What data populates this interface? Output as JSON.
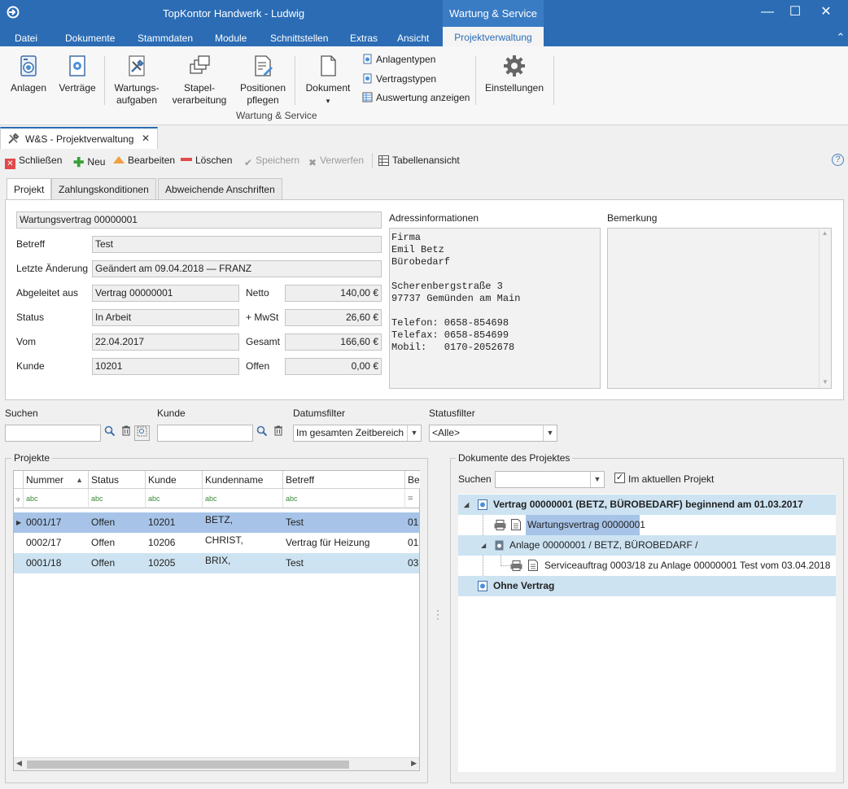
{
  "titlebar": {
    "app_title": "TopKontor Handwerk -  Ludwig",
    "context_group": "Wartung & Service",
    "minimize": "—",
    "maximize": "☐",
    "close": "✕",
    "collapse": "⌃"
  },
  "menu": [
    "Datei",
    "Dokumente",
    "Stammdaten",
    "Module",
    "Schnittstellen",
    "Extras",
    "Ansicht",
    "Projektverwaltung"
  ],
  "ribbon": {
    "anlagen": "Anlagen",
    "vertraege": "Verträge",
    "wartungs_1": "Wartungs-",
    "wartungs_2": "aufgaben",
    "stapel_1": "Stapel-",
    "stapel_2": "verarbeitung",
    "positionen_1": "Positionen",
    "positionen_2": "pflegen",
    "dokument": "Dokument",
    "dokument_arrow": "▾",
    "anlagentypen": "Anlagentypen",
    "vertragstypen": "Vertragstypen",
    "auswertung": "Auswertung anzeigen",
    "einstellungen": "Einstellungen",
    "group_label": "Wartung & Service"
  },
  "doc_tab": {
    "label": "W&S - Projektverwaltung",
    "close": "✕"
  },
  "toolbar": {
    "schliessen": "Schließen",
    "neu": "Neu",
    "bearbeiten": "Bearbeiten",
    "loeschen": "Löschen",
    "speichern": "Speichern",
    "verwerfen": "Verwerfen",
    "tabellenansicht": "Tabellenansicht",
    "help": "?"
  },
  "form_tabs": [
    "Projekt",
    "Zahlungskonditionen",
    "Abweichende Anschriften"
  ],
  "form": {
    "title": "Wartungsvertrag 00000001",
    "betreff_label": "Betreff",
    "betreff": "Test",
    "letzte_label": "Letzte Änderung",
    "letzte": "Geändert am 09.04.2018 — FRANZ",
    "abgeleitet_label": "Abgeleitet aus",
    "abgeleitet": "Vertrag 00000001",
    "status_label": "Status",
    "status": "In Arbeit",
    "vom_label": "Vom",
    "vom": "22.04.2017",
    "kunde_label": "Kunde",
    "kunde": "10201",
    "netto_label": "Netto",
    "netto": "140,00 €",
    "mwst_label": "+ MwSt",
    "mwst": "26,60 €",
    "gesamt_label": "Gesamt",
    "gesamt": "166,60 €",
    "offen_label": "Offen",
    "offen": "0,00 €",
    "adress_label": "Adressinformationen",
    "adress_lines": [
      "Firma",
      "Emil Betz",
      "Bürobedarf",
      "",
      "Scherenbergstraße 3",
      "97737 Gemünden am Main",
      "",
      "Telefon: 0658-854698",
      "Telefax: 0658-854699",
      "Mobil:   0170-2052678"
    ],
    "bemerkung_label": "Bemerkung"
  },
  "filters": {
    "suchen_label": "Suchen",
    "kunde_label": "Kunde",
    "datum_label": "Datumsfilter",
    "datum_value": "Im gesamten Zeitbereich",
    "status_label": "Statusfilter",
    "status_value": "<Alle>"
  },
  "projekte": {
    "title": "Projekte",
    "columns": [
      "Nummer",
      "Status",
      "Kunde",
      "Kundenname",
      "Betreff",
      "Be"
    ],
    "filter_hint": "abc",
    "rows": [
      [
        "0001/17",
        "Offen",
        "10201",
        "BETZ,",
        "Test",
        "01."
      ],
      [
        "0002/17",
        "Offen",
        "10206",
        "CHRIST,",
        "Vertrag für Heizung",
        "01."
      ],
      [
        "0001/18",
        "Offen",
        "10205",
        "BRIX,",
        "Test",
        "03."
      ]
    ]
  },
  "dokumente": {
    "title": "Dokumente des Projektes",
    "suchen_label": "Suchen",
    "checkbox_label": "Im aktuellen Projekt",
    "checkbox_checked": true,
    "nodes": [
      {
        "text": "Vertrag 00000001 (BETZ, BÜROBEDARF) beginnend am 01.03.2017"
      },
      {
        "text": "Wartungsvertrag 00000001"
      },
      {
        "text": "Anlage 00000001 / BETZ, BÜROBEDARF /"
      },
      {
        "text": "Serviceauftrag 0003/18 zu Anlage 00000001 Test vom 03.04.2018"
      },
      {
        "text": "Ohne Vertrag"
      }
    ]
  },
  "colors": {
    "titlebar": "#2b6cb5",
    "selected_row": "#a7c4e8",
    "alt_row": "#cde3f2",
    "tree_group": "#cde3f2"
  }
}
